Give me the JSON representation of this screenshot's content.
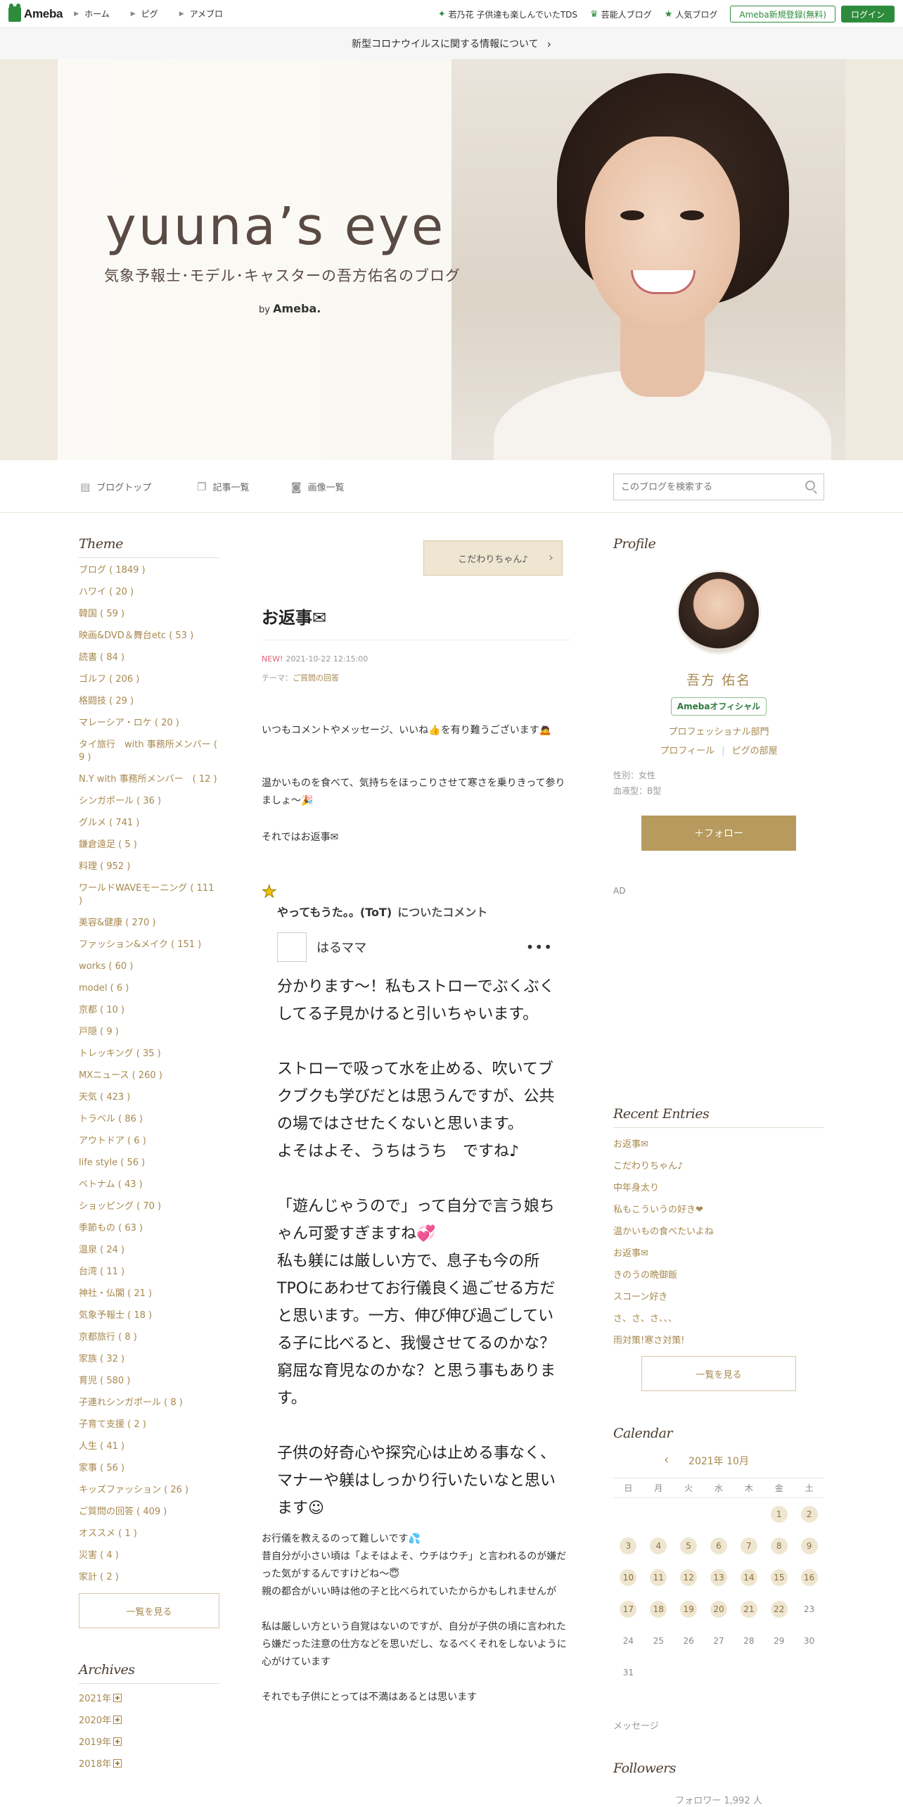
{
  "topbar": {
    "logo": "Ameba",
    "nav": [
      "ホーム",
      "ピグ",
      "アメブロ"
    ],
    "links": [
      {
        "icon": "sparkle-icon",
        "label": "若乃花 子供達も楽しんでいたTDS"
      },
      {
        "icon": "crown-icon",
        "label": "芸能人ブログ"
      },
      {
        "icon": "star-icon",
        "label": "人気ブログ"
      }
    ],
    "register": "Ameba新規登録(無料)",
    "login": "ログイン"
  },
  "notice": {
    "text": "新型コロナウイルスに関する情報について",
    "arrow": "›"
  },
  "header": {
    "title": "yuuna’s eye",
    "subtitle": "気象予報士･モデル･キャスターの吾方佑名のブログ",
    "by": "by",
    "brand": "Ameba."
  },
  "blognav": {
    "items": [
      "ブログトップ",
      "記事一覧",
      "画像一覧"
    ],
    "search_placeholder": "このブログを検索する"
  },
  "themes": {
    "heading": "Theme",
    "items": [
      "ブログ ( 1849 )",
      "ハワイ ( 20 )",
      "韓国 ( 59 )",
      "映画&DVD＆舞台etc ( 53 )",
      "読書 ( 84 )",
      "ゴルフ ( 206 )",
      "格闘技 ( 29 )",
      "マレーシア・ロケ ( 20 )",
      "タイ旅行　with 事務所メンバー ( 9 )",
      "N.Y with 事務所メンバー　( 12 )",
      "シンガポール ( 36 )",
      "グルメ ( 741 )",
      "鎌倉遠足 ( 5 )",
      "料理 ( 952 )",
      "ワールドWAVEモーニング ( 111 )",
      "美容&健康 ( 270 )",
      "ファッション&メイク ( 151 )",
      "works ( 60 )",
      "model ( 6 )",
      "京都 ( 10 )",
      "戸隠 ( 9 )",
      "トレッキング ( 35 )",
      "MXニュース ( 260 )",
      "天気 ( 423 )",
      "トラベル ( 86 )",
      "アウトドア ( 6 )",
      "life style ( 56 )",
      "ベトナム ( 43 )",
      "ショッピング ( 70 )",
      "季節もの ( 63 )",
      "温泉 ( 24 )",
      "台湾 ( 11 )",
      "神社・仏閣 ( 21 )",
      "気象予報士 ( 18 )",
      "京都旅行 ( 8 )",
      "家族 ( 32 )",
      "育児 ( 580 )",
      "子連れシンガポール ( 8 )",
      "子育て支援 ( 2 )",
      "人生 ( 41 )",
      "家事 ( 56 )",
      "キッズファッション ( 26 )",
      "ご質問の回答 ( 409 )",
      "オススメ ( 1 )",
      "災害 ( 4 )",
      "家計 ( 2 )"
    ],
    "more": "一覧を見る"
  },
  "archives": {
    "heading": "Archives",
    "items": [
      "2021年",
      "2020年",
      "2019年",
      "2018年"
    ]
  },
  "entry": {
    "kodawari": "こだわりちゃん♪",
    "title": "お返事✉",
    "new": "NEW!",
    "date": "2021-10-22 12:15:00",
    "theme_label": "テーマ：",
    "theme": "ご質問の回答",
    "p1": "いつもコメントやメッセージ、いいね👍を有り難うございます🙇",
    "p2": "温かいものを食べて、気持ちをほっこりさせて寒さを乗りきって参りましょ～🎉",
    "p3": "それではお返事✉",
    "comment_head": "やってもうた。。(ToT)",
    "comment_head_sub": "についたコメント",
    "commenter": "はるママ",
    "c1": "分かります～！私もストローでぶくぶくしてる子見かけると引いちゃいます。",
    "c2": "ストローで吸って水を止める、吹いてブクブクも学びだとは思うんですが、公共の場ではさせたくないと思います。",
    "c3": "よそはよそ、うちはうち　ですね♪",
    "c4": "「遊んじゃうので」って自分で言う娘ちゃん可愛すぎますね💞",
    "c5": "私も躾には厳しい方で、息子も今の所TPOにあわせてお行儀良く過ごせる方だと思います。一方、伸び伸び過ごしている子に比べると、我慢させてるのかな？窮屈な育児なのかな？と思う事もあります。",
    "c6": "子供の好奇心や探究心は止める事なく、マナーや躾はしっかり行いたいなと思います☺",
    "a1": "お行儀を教えるのって難しいです💦",
    "a2": "昔自分が小さい頃は「よそはよそ、ウチはウチ」と言われるのが嫌だった気がするんですけどね～😇",
    "a3": "親の都合がいい時は他の子と比べられていたからかもしれませんが",
    "a4": "私は厳しい方という自覚はないのですが、自分が子供の頃に言われたら嫌だった注意の仕方などを思いだし、なるべくそれをしないように心がけています",
    "a5": "それでも子供にとっては不満はあるとは思います"
  },
  "profile": {
    "heading": "Profile",
    "name": "吾方 佑名",
    "badge": "Amebaオフィシャル",
    "category": "プロフェッショナル部門",
    "link1": "プロフィール",
    "link2": "ピグの部屋",
    "sex": "性別：女性",
    "blood": "血液型：B型",
    "follow": "＋フォロー",
    "ad": "AD"
  },
  "recent": {
    "heading": "Recent Entries",
    "items": [
      "お返事✉",
      "こだわりちゃん♪",
      "中年身太り",
      "私もこういうの好き❤",
      "温かいもの食べたいよね",
      "お返事✉",
      "きのうの晩御飯",
      "スコーン好き",
      "さ、さ、さ、、、",
      "雨対策!寒さ対策!"
    ],
    "more": "一覧を見る"
  },
  "calendar": {
    "heading": "Calendar",
    "prev": "‹",
    "month": "2021年 10月",
    "weekdays": [
      "日",
      "月",
      "火",
      "水",
      "木",
      "金",
      "土"
    ],
    "days": [
      "",
      "",
      "",
      "",
      "",
      "1",
      "2",
      "3",
      "4",
      "5",
      "6",
      "7",
      "8",
      "9",
      "10",
      "11",
      "12",
      "13",
      "14",
      "15",
      "16",
      "17",
      "18",
      "19",
      "20",
      "21",
      "22",
      "23",
      "24",
      "25",
      "26",
      "27",
      "28",
      "29",
      "30",
      "31"
    ],
    "linked_days": [
      "1",
      "2",
      "3",
      "4",
      "5",
      "6",
      "7",
      "8",
      "9",
      "10",
      "11",
      "12",
      "13",
      "14",
      "15",
      "16",
      "17",
      "18",
      "19",
      "20",
      "21",
      "22"
    ]
  },
  "message": "メッセージ",
  "followers": {
    "heading": "Followers",
    "count": "フォロワー 1,992 人"
  }
}
